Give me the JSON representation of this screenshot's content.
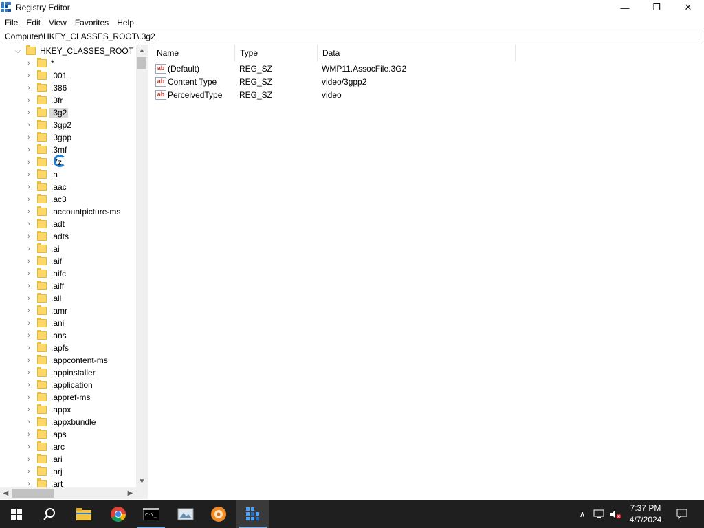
{
  "window": {
    "title": "Registry Editor",
    "controls": {
      "minimize": "—",
      "maximize": "❐",
      "close": "✕"
    }
  },
  "menu": [
    "File",
    "Edit",
    "View",
    "Favorites",
    "Help"
  ],
  "address": "Computer\\HKEY_CLASSES_ROOT\\.3g2",
  "tree": {
    "root": "HKEY_CLASSES_ROOT",
    "selected": ".3g2",
    "items": [
      "*",
      ".001",
      ".386",
      ".3fr",
      ".3g2",
      ".3gp2",
      ".3gpp",
      ".3mf",
      ".7z",
      ".a",
      ".aac",
      ".ac3",
      ".accountpicture-ms",
      ".adt",
      ".adts",
      ".ai",
      ".aif",
      ".aifc",
      ".aiff",
      ".all",
      ".amr",
      ".ani",
      ".ans",
      ".apfs",
      ".appcontent-ms",
      ".appinstaller",
      ".application",
      ".appref-ms",
      ".appx",
      ".appxbundle",
      ".aps",
      ".arc",
      ".ari",
      ".arj",
      ".art"
    ]
  },
  "values_pane": {
    "columns": [
      "Name",
      "Type",
      "Data"
    ],
    "rows": [
      {
        "icon": "ab",
        "name": "(Default)",
        "type": "REG_SZ",
        "data": "WMP11.AssocFile.3G2"
      },
      {
        "icon": "ab",
        "name": "Content Type",
        "type": "REG_SZ",
        "data": "video/3gpp2"
      },
      {
        "icon": "ab",
        "name": "PerceivedType",
        "type": "REG_SZ",
        "data": "video"
      }
    ]
  },
  "taskbar": {
    "apps": [
      "start-icon",
      "search-icon",
      "file-explorer-icon",
      "chrome-icon",
      "terminal-icon",
      "photo-viewer-icon",
      "media-app-icon",
      "registry-editor-icon"
    ],
    "active_app": "registry-editor-icon",
    "tray": {
      "chevron": "∧",
      "time": "7:37 PM",
      "date": "4/7/2024"
    }
  },
  "colors": {
    "taskbar": "#1f1f1f",
    "accent": "#2d7dd2",
    "folder": "#fcd76a",
    "selection": "#d9d9d9"
  }
}
